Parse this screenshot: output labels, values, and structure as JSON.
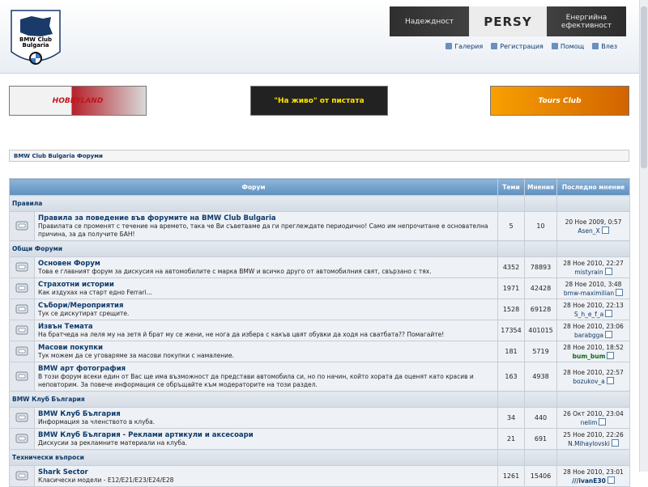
{
  "header": {
    "logo_text": "BMW Club Bulgaria",
    "persy_left": "Надеждност",
    "persy_brand": "PERSY",
    "persy_right": "Енергийна ефективност"
  },
  "toplinks": [
    {
      "label": "Галерия",
      "icon": "gallery-icon"
    },
    {
      "label": "Регистрация",
      "icon": "register-icon"
    },
    {
      "label": "Помощ",
      "icon": "help-icon"
    },
    {
      "label": "Влез",
      "icon": "login-icon"
    }
  ],
  "banners": {
    "b1": "HOBBYLAND",
    "b2": "\"На живо\" от пистата",
    "b3": "Tours Club"
  },
  "breadcrumb": "BMW Club Bulgaria Форуми",
  "columns": {
    "forum": "Форум",
    "topics": "Теми",
    "posts": "Мнения",
    "last": "Последно мнение"
  },
  "categories": [
    {
      "name": "Правила",
      "forums": [
        {
          "title": "Правила за поведение във форумите на BMW Club Bulgaria",
          "desc": "Правилата се променят с течение на времето, така че Ви съветваме да ги преглеждате периодично! Само им непрочитане е основателна причина, за да получите БАН!",
          "topics": "5",
          "posts": "10",
          "date": "20 Ное 2009, 0:57",
          "user": "Asen_X",
          "ustyle": ""
        }
      ]
    },
    {
      "name": "Общи Форуми",
      "forums": [
        {
          "title": "Основен Форум",
          "desc": "Това е главният форум за дискусия на автомобилите с марка BMW и всичко друго от автомобилния свят, свързано с тях.",
          "topics": "4352",
          "posts": "78893",
          "date": "28 Ное 2010, 22:27",
          "user": "mistyrain",
          "ustyle": ""
        },
        {
          "title": "Страхотни истории",
          "desc": "Как издухах на старт едно Ferrari...",
          "topics": "1971",
          "posts": "42428",
          "date": "28 Ное 2010, 3:48",
          "user": "bmw-maximilian",
          "ustyle": ""
        },
        {
          "title": "Събори/Мероприятия",
          "desc": "Тук се дискутират срещите.",
          "topics": "1528",
          "posts": "69128",
          "date": "28 Ное 2010, 22:13",
          "user": "S_h_e_f_a",
          "ustyle": ""
        },
        {
          "title": "Извън Темата",
          "desc": "На братчеда на леля му на зетя й брат му се жени, не нога да избера с какъв цвят обувки да ходя на сватбата?? Помагайте!",
          "topics": "17354",
          "posts": "401015",
          "date": "28 Ное 2010, 23:06",
          "user": "barabgga",
          "ustyle": ""
        },
        {
          "title": "Масови покупки",
          "desc": "Тук можем да се уговаряме за масови покупки с намаление.",
          "topics": "181",
          "posts": "5719",
          "date": "28 Ное 2010, 18:52",
          "user": "bum_bum",
          "ustyle": "g"
        },
        {
          "title": "BMW арт фотография",
          "desc": "В този форум всеки един от Вас ще има възможност да представи автомобила си, но по начин, който хората да оценят като красив и неповторим. За повече информация се обръщайте към модераторите на този раздел.",
          "topics": "163",
          "posts": "4938",
          "date": "28 Ное 2010, 22:57",
          "user": "bozukov_a",
          "ustyle": ""
        }
      ]
    },
    {
      "name": "BMW Клуб България",
      "forums": [
        {
          "title": "BMW Клуб България",
          "desc": "Информация за членството в клуба.",
          "topics": "34",
          "posts": "440",
          "date": "26 Окт 2010, 23:04",
          "user": "nelim",
          "ustyle": ""
        },
        {
          "title": "BMW Клуб България - Реклами артикули и аксесоари",
          "desc": "Дискусии за рекламните материали на клуба.",
          "topics": "21",
          "posts": "691",
          "date": "25 Ное 2010, 22:26",
          "user": "N.Mihaylovski",
          "ustyle": ""
        }
      ]
    },
    {
      "name": "Технически въпроси",
      "forums": [
        {
          "title": "Shark Sector",
          "desc": "Класически модели - E12/E21/E23/E24/E28",
          "topics": "1261",
          "posts": "15406",
          "date": "28 Ное 2010, 23:01",
          "user": "///ivanE30",
          "ustyle": "bl"
        }
      ]
    }
  ]
}
